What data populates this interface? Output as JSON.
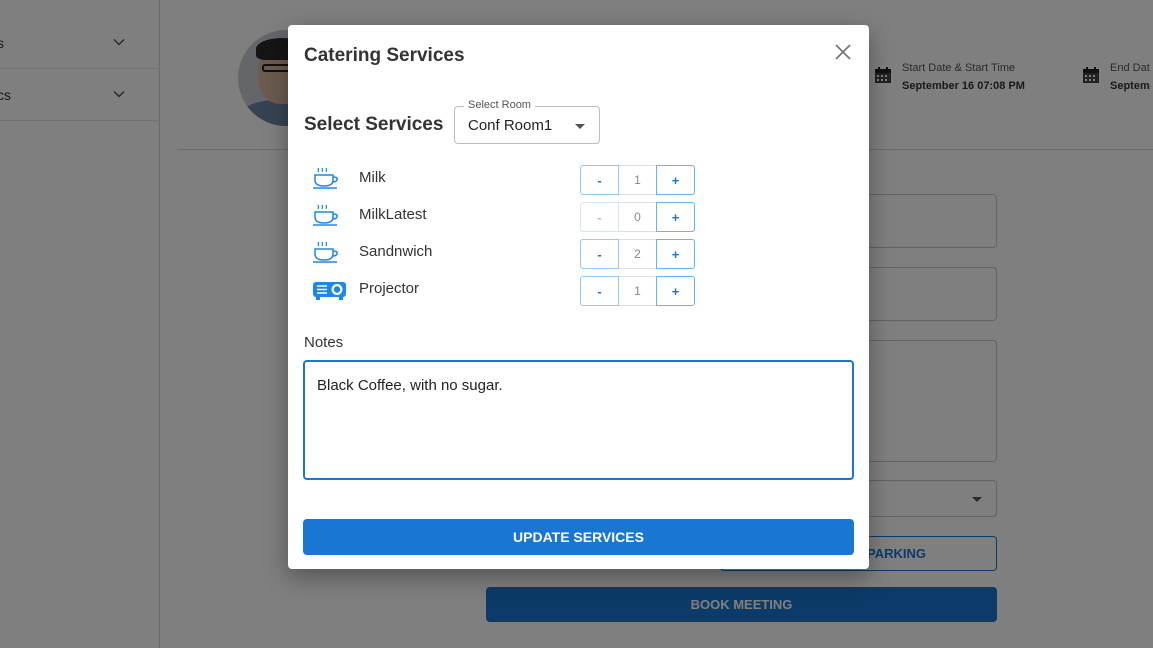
{
  "background": {
    "sidebar": {
      "top_label": "",
      "items": [
        {
          "label": "s"
        },
        {
          "label": "cs"
        }
      ]
    },
    "header": {
      "start": {
        "label": "Start Date & Start Time",
        "value": "September 16 07:08 PM"
      },
      "end": {
        "label": "End Dat",
        "value": "Septem"
      }
    },
    "buttons": {
      "parking": "PARKING",
      "book_meeting": "BOOK MEETING"
    }
  },
  "modal": {
    "title": "Catering Services",
    "services_heading": "Select Services",
    "room_select": {
      "legend": "Select Room",
      "value": "Conf Room1"
    },
    "services": [
      {
        "name": "Milk",
        "icon": "coffee-cup-icon",
        "quantity": "1",
        "minus": "-",
        "plus": "+"
      },
      {
        "name": "MilkLatest",
        "icon": "coffee-cup-icon",
        "quantity": "0",
        "minus": "-",
        "plus": "+"
      },
      {
        "name": "Sandnwich",
        "icon": "coffee-cup-icon",
        "quantity": "2",
        "minus": "-",
        "plus": "+"
      },
      {
        "name": "Projector",
        "icon": "projector-icon",
        "quantity": "1",
        "minus": "-",
        "plus": "+"
      }
    ],
    "notes_label": "Notes",
    "notes_value": "Black Coffee, with no sugar.",
    "update_button": "UPDATE SERVICES"
  },
  "colors": {
    "primary": "#1976d2",
    "overlay": "rgba(0,0,0,0.5)"
  }
}
